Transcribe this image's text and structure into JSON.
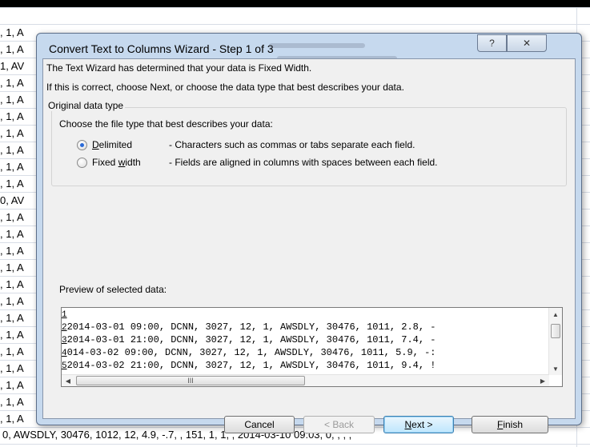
{
  "sheet": {
    "left_fragments": [
      ", 1, A",
      ", 1, A",
      "1, AV",
      ", 1, A",
      ", 1, A",
      ", 1, A",
      ", 1, A",
      ", 1, A",
      ", 1, A",
      ", 1, A",
      "0, AV",
      ", 1, A",
      ", 1, A",
      ", 1, A",
      ", 1, A",
      ", 1, A",
      ", 1, A",
      ", 1, A",
      ", 1, A",
      ", 1, A",
      ", 1, A",
      ", 1, A",
      ", 1, A",
      ", 1, A"
    ],
    "bottom_row": "0, AWSDLY, 30476, 1012, 12, 4.9, -.7, , 151, 1, 1, , 2014-03-10 09:03, 0, , , ,"
  },
  "dialog": {
    "title": "Convert Text to Columns Wizard - Step 1 of 3",
    "help_glyph": "?",
    "close_glyph": "✕",
    "line1": "The Text Wizard has determined that your data is Fixed Width.",
    "line2": "If this is correct, choose Next, or choose the data type that best describes your data.",
    "group_label": "Original data type",
    "choose_label": "Choose the file type that best describes your data:",
    "options": [
      {
        "label_pre": "",
        "mnemonic": "D",
        "label_post": "elimited",
        "description": "- Characters such as commas or tabs separate each field.",
        "selected": true
      },
      {
        "label_pre": "Fixed ",
        "mnemonic": "w",
        "label_post": "idth",
        "description": "- Fields are aligned in columns with spaces between each field.",
        "selected": false
      }
    ],
    "preview_label": "Preview of selected data:",
    "preview_lines": [
      {
        "num": "1",
        "text": ""
      },
      {
        "num": "2",
        "text": "2014-03-01 09:00, DCNN, 3027, 12, 1, AWSDLY, 30476, 1011, 2.8, -"
      },
      {
        "num": "3",
        "text": "2014-03-01 21:00, DCNN, 3027, 12, 1, AWSDLY, 30476, 1011, 7.4, -"
      },
      {
        "num": "4",
        "text": "014-03-02 09:00, DCNN, 3027, 12, 1, AWSDLY, 30476, 1011, 5.9, -:"
      },
      {
        "num": "5",
        "text": "2014-03-02 21:00, DCNN, 3027, 12, 1, AWSDLY, 30476, 1011, 9.4, !"
      }
    ],
    "scroll_up_glyph": "▲",
    "scroll_down_glyph": "▼",
    "scroll_left_glyph": "◀",
    "scroll_right_glyph": "▶",
    "hscroll_grip": "III",
    "buttons": {
      "cancel": "Cancel",
      "back": "< Back",
      "next_mnemonic": "N",
      "next_rest": "ext >",
      "finish_mnemonic": "F",
      "finish_rest": "inish"
    }
  }
}
